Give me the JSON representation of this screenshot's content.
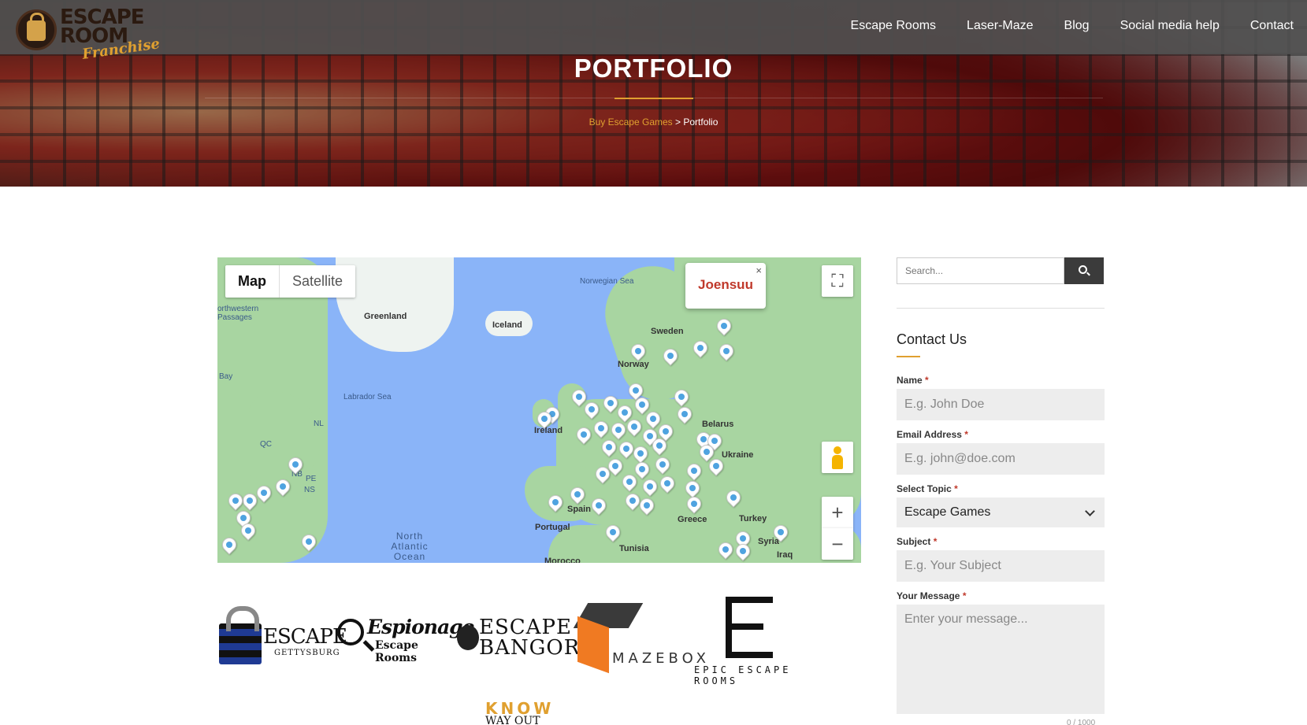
{
  "logo": {
    "line1": "ESCAPE",
    "line2": "ROOM",
    "sub": "Franchise"
  },
  "nav": {
    "items": [
      "Escape Rooms",
      "Laser-Maze",
      "Blog",
      "Social media help",
      "Contact"
    ]
  },
  "hero": {
    "title": "PORTFOLIO",
    "breadcrumb_link": "Buy Escape Games",
    "breadcrumb_sep": " > ",
    "breadcrumb_current": "Portfolio"
  },
  "map": {
    "toggle_map": "Map",
    "toggle_satellite": "Satellite",
    "popup_title": "Joensuu",
    "popup_close": "×",
    "fullscreen_icon": "⛶",
    "zoom_in": "+",
    "zoom_out": "−",
    "labels": {
      "norwegian_sea": "Norwegian Sea",
      "greenland": "Greenland",
      "iceland": "Iceland",
      "sweden": "Sweden",
      "norway": "Norway",
      "labrador_sea": "Labrador Sea",
      "ireland": "Ireland",
      "belarus": "Belarus",
      "ukraine": "Ukraine",
      "spain": "Spain",
      "portugal": "Portugal",
      "greece": "Greece",
      "turkey": "Turkey",
      "syria": "Syria",
      "iraq": "Iraq",
      "tunisia": "Tunisia",
      "morocco": "Morocco",
      "north_atlantic": "North Atlantic Ocean",
      "nw_passages": "orthwestern Passages",
      "bay": "Bay",
      "qc": "QC",
      "nl": "NL",
      "nb": "NB",
      "pe": "PE",
      "ns": "NS"
    }
  },
  "partner_logos": {
    "escape_gettysburg": {
      "t1": "ESCAPE",
      "t2": "GETTYSBURG"
    },
    "espionage": {
      "t1": "Espionage",
      "t2": "Escape Rooms"
    },
    "bangor": {
      "t1": "ESCAPE",
      "t2": "BANGOR"
    },
    "mazebox": {
      "t1": "MAZEBOX"
    },
    "epic": {
      "t1": "EPIC ESCAPE ROOMS"
    },
    "know": {
      "t1": "KNOW",
      "t2": "WAY OUT"
    }
  },
  "sidebar": {
    "search_placeholder": "Search...",
    "contact_title": "Contact Us",
    "name_label": "Name",
    "name_placeholder": "E.g. John Doe",
    "email_label": "Email Address",
    "email_placeholder": "E.g. john@doe.com",
    "topic_label": "Select Topic",
    "topic_selected": "Escape Games",
    "subject_label": "Subject",
    "subject_placeholder": "E.g. Your Subject",
    "message_label": "Your Message",
    "message_placeholder": "Enter your message...",
    "required_mark": "*",
    "counter": "0 / 1000"
  },
  "colors": {
    "accent": "#e0a030",
    "nav_bar": "#505050",
    "popup_title": "#c0392b",
    "map_water": "#8ab4f8",
    "map_land": "#a8d5a1"
  }
}
